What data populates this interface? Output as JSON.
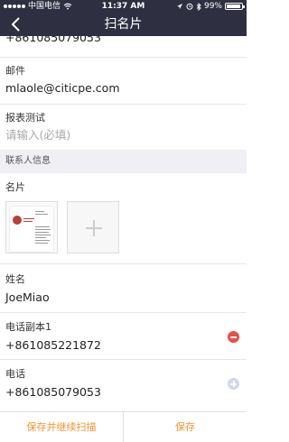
{
  "status_bar": {
    "carrier": "中国电信",
    "time": "11:37 AM",
    "battery": "99%"
  },
  "nav": {
    "title": "扫名片"
  },
  "fields": {
    "phone_top_value": "+861085079053",
    "email_label": "邮件",
    "email_value": "mlaole@citicpe.com",
    "report_label": "报表测试",
    "report_placeholder": "请输入(必填)",
    "contact_section": "联系人信息",
    "card_label": "名片",
    "name_label": "姓名",
    "name_value": "JoeMiao",
    "phone_sub_label": "电话副本1",
    "phone_sub_value": "+861085221872",
    "phone_label": "电话",
    "phone_value": "+861085079053"
  },
  "actions": {
    "save_continue": "保存并继续扫描",
    "save": "保存"
  }
}
